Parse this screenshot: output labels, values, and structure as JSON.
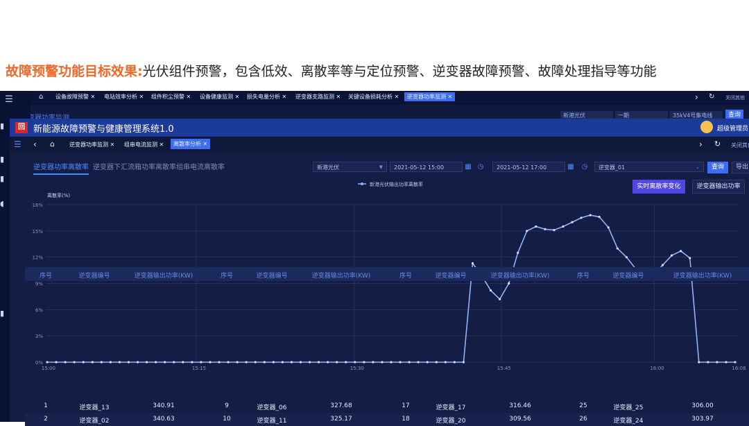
{
  "slide": {
    "title_accent": "故障预警功能目标效果:",
    "title_rest": "光伏组件预警，包含低效、离散率等与定位预警、逆变器故障预警、故障处理指导等功能"
  },
  "bg_window": {
    "tabs": [
      "设备故障预警 ✕",
      "电站效率分析 ✕",
      "组件积尘预警 ✕",
      "设备健康监测 ✕",
      "损失电量分析 ✕",
      "逆变器支路监测 ✕",
      "关键设备损耗分析 ✕",
      "逆变器功率监测 ✕"
    ],
    "active_tab_index": 7,
    "close_others": "关闭其他",
    "subtitle": "逆变器功率监测",
    "station": "新港光伏",
    "area": "一期",
    "line": "35kV4号集电线",
    "query": "查询"
  },
  "app": {
    "logo": "回",
    "title": "新能源故障预警与健康管理系统1.0",
    "user": "超级管理员 ▾",
    "close_others": "关闭其他"
  },
  "tabs": [
    "逆变器功率监测 ✕",
    "组串电流监测 ✕",
    "离散率分析 ✕"
  ],
  "active_tab_index": 2,
  "subtabs": [
    "逆变器功率离散率",
    "逆变器下汇流箱功率离散率",
    "组串电流离散率"
  ],
  "active_subtab_index": 0,
  "filters": {
    "station": "新港光伏",
    "start": "2021-05-12 15:00",
    "end": "2021-05-12 17:00",
    "inverter": "逆变器_01",
    "query": "查询",
    "export": "导出"
  },
  "actions": {
    "realtime": "实时离散率变化",
    "output": "逆变器输出功率"
  },
  "colors": {
    "accent": "#3d6df2",
    "line": "#8fb4ff",
    "title_accent": "#f0672a"
  },
  "chart_data": {
    "type": "line",
    "ylabel": "离散率(%)",
    "ylim": [
      0,
      18
    ],
    "yticks": [
      "0%",
      "3%",
      "6%",
      "9%",
      "12%",
      "15%",
      "18%"
    ],
    "xticks": [
      "15:00",
      "15:15",
      "15:30",
      "15:45",
      "16:00",
      "16:08"
    ],
    "legend": "新港光伏输出功率离散率",
    "legend_position": "top-center",
    "grid": true,
    "series": [
      {
        "name": "新港光伏输出功率离散率",
        "values": [
          0,
          0,
          0,
          0,
          0,
          0,
          0,
          0,
          0,
          0,
          0,
          0,
          0,
          0,
          0,
          0,
          0,
          0,
          0,
          0,
          0,
          0,
          0,
          0,
          0,
          0,
          0,
          0,
          0,
          0,
          0,
          0,
          0,
          0,
          0,
          0,
          0,
          0,
          0,
          0,
          0,
          0,
          0,
          0,
          0,
          0,
          0,
          11.3,
          9.9,
          8.2,
          7.2,
          9.0,
          12.5,
          15.0,
          15.5,
          15.2,
          15.1,
          15.5,
          16.0,
          16.5,
          16.8,
          16.6,
          15.4,
          13.0,
          12.0,
          10.7,
          9.9,
          10.0,
          11.1,
          12.2,
          12.7,
          11.9,
          0,
          0,
          0,
          0,
          0
        ]
      }
    ]
  },
  "table": {
    "headers": [
      "序号",
      "逆变器编号",
      "逆变器输出功率(KW)",
      "序号",
      "逆变器编号",
      "逆变器输出功率(KW)",
      "序号",
      "逆变器编号",
      "逆变器输出功率(KW)",
      "序号",
      "逆变器编号",
      "逆变器输出功率(KW)"
    ],
    "rows": [
      [
        "1",
        "逆变器_13",
        "340.91",
        "9",
        "逆变器_06",
        "327.68",
        "17",
        "逆变器_17",
        "316.46",
        "25",
        "逆变器_25",
        "306.00"
      ],
      [
        "2",
        "逆变器_02",
        "340.63",
        "10",
        "逆变器_11",
        "325.17",
        "18",
        "逆变器_20",
        "309.56",
        "26",
        "逆变器_24",
        "303.97"
      ]
    ]
  }
}
